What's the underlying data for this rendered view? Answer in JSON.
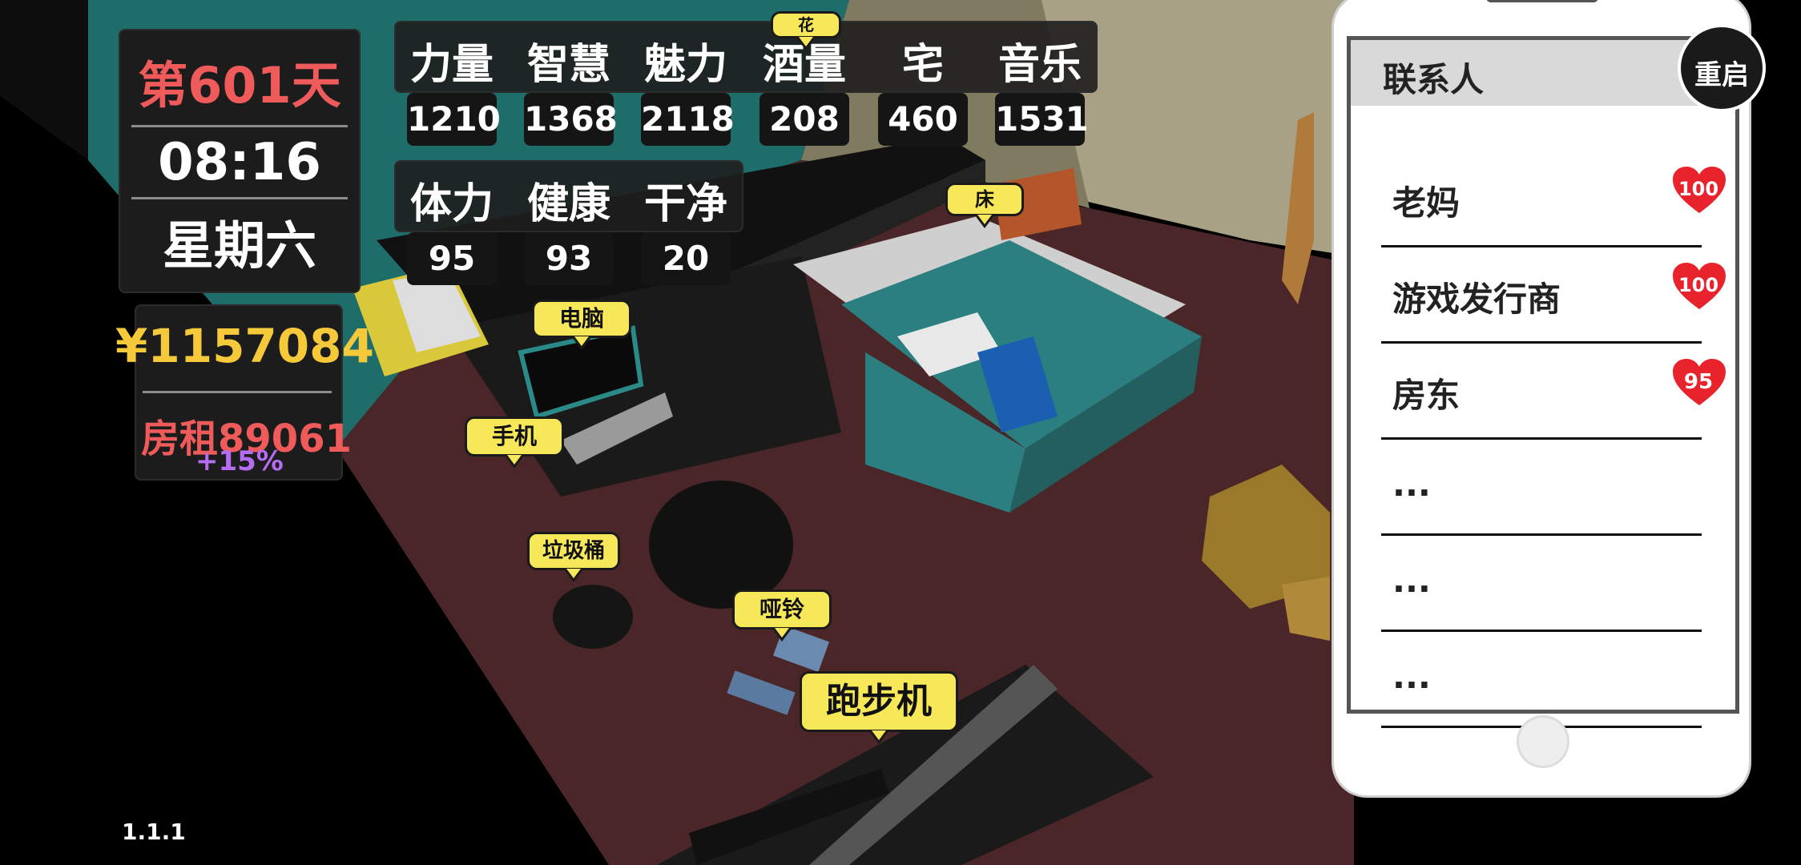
{
  "hud": {
    "day": "第601天",
    "time": "08:16",
    "weekday": "星期六",
    "money": "¥1157084",
    "rent": "房租89061",
    "rent_change": "+15%"
  },
  "stats_row1": [
    {
      "label": "力量",
      "value": "1210"
    },
    {
      "label": "智慧",
      "value": "1368"
    },
    {
      "label": "魅力",
      "value": "2118"
    },
    {
      "label": "酒量",
      "value": "208"
    },
    {
      "label": "宅",
      "value": "460"
    },
    {
      "label": "音乐",
      "value": "1531"
    }
  ],
  "stats_row2": [
    {
      "label": "体力",
      "value": "95"
    },
    {
      "label": "健康",
      "value": "93"
    },
    {
      "label": "干净",
      "value": "20"
    }
  ],
  "tags": {
    "computer": "电脑",
    "phone": "手机",
    "trash": "垃圾桶",
    "dumbbell": "哑铃",
    "treadmill": "跑步机",
    "bed": "床",
    "flower": "花"
  },
  "phone": {
    "restart": "重启",
    "header": "联系人",
    "contacts": [
      {
        "name": "老妈",
        "score": "100"
      },
      {
        "name": "游戏发行商",
        "score": "100"
      },
      {
        "name": "房东",
        "score": "95"
      },
      {
        "name": "..."
      },
      {
        "name": "..."
      },
      {
        "name": "..."
      }
    ]
  },
  "version": "1.1.1",
  "colors": {
    "accent_red": "#ef5a5a",
    "gold": "#f5c93a",
    "tag_yellow": "#f7e85a",
    "heart_red": "#e8232c",
    "purple": "#b46cf0"
  }
}
